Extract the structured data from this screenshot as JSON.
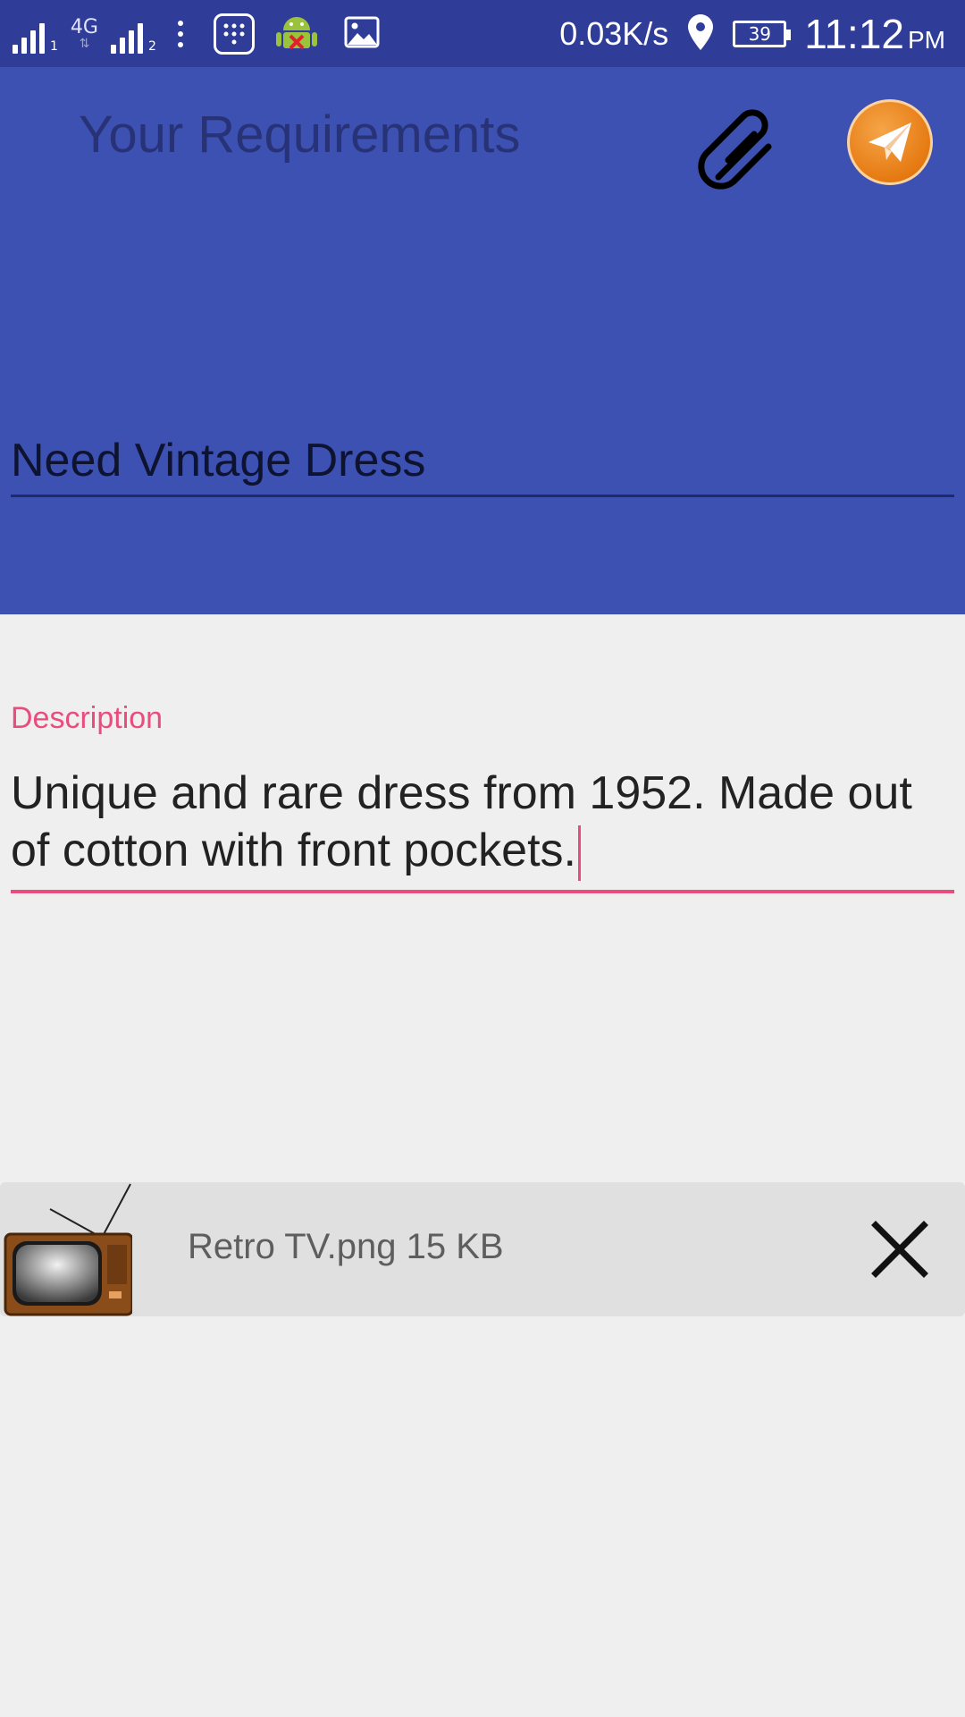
{
  "status_bar": {
    "sim1_indicator": "1",
    "network_type": "4G",
    "sim2_indicator": "2",
    "net_speed": "0.03K/s",
    "battery_level": "39",
    "time": "11:12",
    "ampm": "PM",
    "icons": [
      "signal-icon",
      "signal-icon",
      "more-icon",
      "dialpad-icon",
      "android-icon",
      "image-icon",
      "location-icon",
      "battery-icon"
    ]
  },
  "app_bar": {
    "title": "Your Requirements",
    "attach_icon": "paperclip-icon",
    "send_icon": "paper-plane-icon",
    "background": "#3d51b3"
  },
  "form": {
    "title_value": "Need Vintage Dress",
    "description_label": "Description",
    "description_value": "Unique and rare dress from 1952. Made out of cotton with front pockets.",
    "accent_color": "#e84d7e"
  },
  "attachment": {
    "label": "Retro TV.png 15 KB",
    "thumbnail_icon": "retro-tv-icon",
    "remove_icon": "close-icon"
  }
}
